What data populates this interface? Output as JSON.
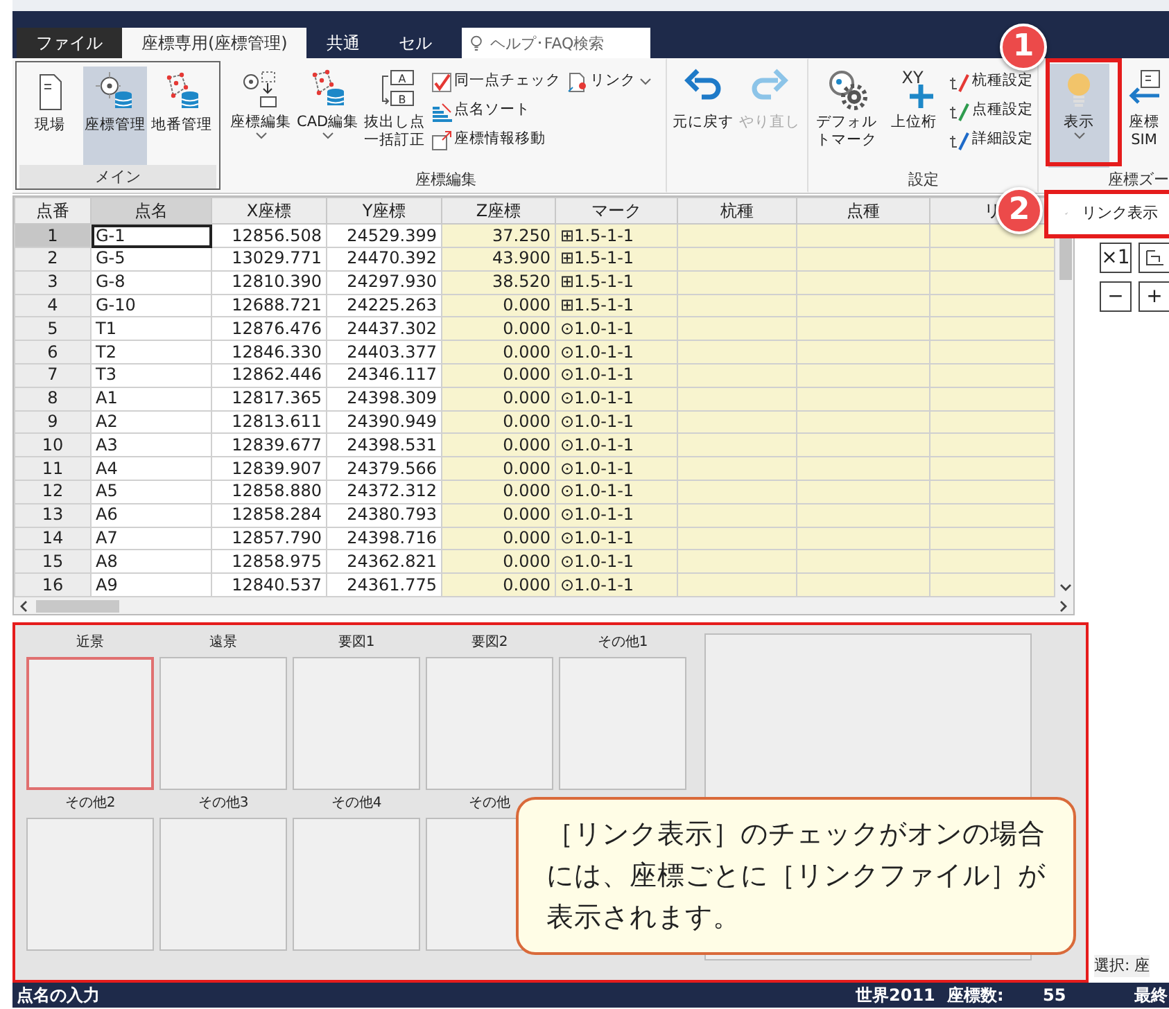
{
  "tabs": [
    {
      "label": "ファイル",
      "kind": "file",
      "selected": false
    },
    {
      "label": "座標専用(座標管理)",
      "kind": "tab",
      "selected": true
    },
    {
      "label": "共通",
      "kind": "tab",
      "selected": false
    },
    {
      "label": "セル",
      "kind": "tab",
      "selected": false
    }
  ],
  "search": {
    "placeholder": "ヘルプ･FAQ検索"
  },
  "ribbon_groups": [
    {
      "title": "メイン",
      "outlined": true,
      "items": [
        {
          "kind": "large",
          "label": "現場",
          "selected": false,
          "dropdown": false,
          "disabled": false
        },
        {
          "kind": "large",
          "label": "座標管理",
          "selected": true,
          "dropdown": false,
          "disabled": false
        },
        {
          "kind": "large",
          "label": "地番管理",
          "selected": false,
          "dropdown": false,
          "disabled": false
        }
      ]
    },
    {
      "title": "座標編集",
      "outlined": false,
      "items": [
        {
          "kind": "large",
          "label": "座標編集",
          "selected": false,
          "dropdown": true,
          "disabled": false
        },
        {
          "kind": "large",
          "label": "CAD編集",
          "selected": false,
          "dropdown": true,
          "disabled": false
        },
        {
          "kind": "large",
          "label": "抜出し点一括訂正",
          "icon_text": [
            "A",
            "B"
          ],
          "selected": false,
          "dropdown": false,
          "disabled": false
        },
        {
          "kind": "small",
          "label": "同一点チェック",
          "dropdown": false
        },
        {
          "kind": "small",
          "label": "点名ソート",
          "dropdown": false
        },
        {
          "kind": "small",
          "label": "座標情報移動",
          "dropdown": false
        },
        {
          "kind": "small",
          "label": "リンク",
          "dropdown": true
        }
      ]
    },
    {
      "outlined": false,
      "items": [
        {
          "kind": "large",
          "label": "元に戻す",
          "selected": false,
          "dropdown": false,
          "disabled": false
        },
        {
          "kind": "large",
          "label": "やり直し",
          "selected": false,
          "dropdown": false,
          "disabled": true
        }
      ]
    },
    {
      "title": "設定",
      "outlined": false,
      "items": [
        {
          "kind": "large",
          "label": "デフォルトマーク",
          "selected": false,
          "dropdown": false,
          "disabled": false
        },
        {
          "kind": "large",
          "label": "上位桁",
          "icon_text": [
            "XY"
          ],
          "selected": false,
          "dropdown": false,
          "disabled": false
        },
        {
          "kind": "small",
          "label": "杭種設定",
          "dropdown": false
        },
        {
          "kind": "small",
          "label": "点種設定",
          "dropdown": false
        },
        {
          "kind": "small",
          "label": "詳細設定",
          "dropdown": false
        }
      ]
    },
    {
      "title": "座標ズー",
      "outlined": false,
      "items": [
        {
          "kind": "large",
          "label": "表示",
          "selected": true,
          "dropdown": true,
          "disabled": false
        },
        {
          "kind": "large",
          "label": "座標\nSIM",
          "selected": false,
          "dropdown": false,
          "disabled": false
        }
      ]
    }
  ],
  "table": {
    "columns": [
      {
        "label": "点番",
        "kind": "number",
        "shaded": false,
        "selected": false
      },
      {
        "label": "点名",
        "kind": "name",
        "shaded": false,
        "selected": true
      },
      {
        "label": "X座標",
        "kind": "coord",
        "shaded": false,
        "selected": false
      },
      {
        "label": "Y座標",
        "kind": "coord",
        "shaded": false,
        "selected": false
      },
      {
        "label": "Z座標",
        "kind": "coord",
        "shaded": true,
        "selected": false
      },
      {
        "label": "マーク",
        "kind": "mark",
        "shaded": true,
        "selected": false
      },
      {
        "label": "杭種",
        "kind": "empty",
        "shaded": true,
        "selected": false
      },
      {
        "label": "点種",
        "kind": "empty",
        "shaded": true,
        "selected": false
      },
      {
        "label": "リ",
        "kind": "empty",
        "shaded": true,
        "selected": false
      }
    ],
    "rows": [
      {
        "selected": true,
        "cells": [
          "1",
          "G-1",
          "12856.508",
          "24529.399",
          "37.250",
          "⊞1.5-1-1"
        ]
      },
      {
        "selected": false,
        "cells": [
          "2",
          "G-5",
          "13029.771",
          "24470.392",
          "43.900",
          "⊞1.5-1-1"
        ]
      },
      {
        "selected": false,
        "cells": [
          "3",
          "G-8",
          "12810.390",
          "24297.930",
          "38.520",
          "⊞1.5-1-1"
        ]
      },
      {
        "selected": false,
        "cells": [
          "4",
          "G-10",
          "12688.721",
          "24225.263",
          "0.000",
          "⊞1.5-1-1"
        ]
      },
      {
        "selected": false,
        "cells": [
          "5",
          "T1",
          "12876.476",
          "24437.302",
          "0.000",
          "⊙1.0-1-1"
        ]
      },
      {
        "selected": false,
        "cells": [
          "6",
          "T2",
          "12846.330",
          "24403.377",
          "0.000",
          "⊙1.0-1-1"
        ]
      },
      {
        "selected": false,
        "cells": [
          "7",
          "T3",
          "12862.446",
          "24346.117",
          "0.000",
          "⊙1.0-1-1"
        ]
      },
      {
        "selected": false,
        "cells": [
          "8",
          "A1",
          "12817.365",
          "24398.309",
          "0.000",
          "⊙1.0-1-1"
        ]
      },
      {
        "selected": false,
        "cells": [
          "9",
          "A2",
          "12813.611",
          "24390.949",
          "0.000",
          "⊙1.0-1-1"
        ]
      },
      {
        "selected": false,
        "cells": [
          "10",
          "A3",
          "12839.677",
          "24398.531",
          "0.000",
          "⊙1.0-1-1"
        ]
      },
      {
        "selected": false,
        "cells": [
          "11",
          "A4",
          "12839.907",
          "24379.566",
          "0.000",
          "⊙1.0-1-1"
        ]
      },
      {
        "selected": false,
        "cells": [
          "12",
          "A5",
          "12858.880",
          "24372.312",
          "0.000",
          "⊙1.0-1-1"
        ]
      },
      {
        "selected": false,
        "cells": [
          "13",
          "A6",
          "12858.284",
          "24380.793",
          "0.000",
          "⊙1.0-1-1"
        ]
      },
      {
        "selected": false,
        "cells": [
          "14",
          "A7",
          "12857.790",
          "24398.716",
          "0.000",
          "⊙1.0-1-1"
        ]
      },
      {
        "selected": false,
        "cells": [
          "15",
          "A8",
          "12858.975",
          "24362.821",
          "0.000",
          "⊙1.0-1-1"
        ]
      },
      {
        "selected": false,
        "cells": [
          "16",
          "A9",
          "12840.537",
          "24361.775",
          "0.000",
          "⊙1.0-1-1"
        ]
      }
    ]
  },
  "display_menu": {
    "items": [
      {
        "label": "リンク表示",
        "checked": true
      }
    ]
  },
  "zoom_buttons": [
    {
      "kind": "text",
      "label": "×1"
    },
    {
      "kind": "fit"
    },
    {
      "kind": "text",
      "label": "−"
    },
    {
      "kind": "text",
      "label": "+"
    }
  ],
  "link_panel": {
    "thumbnails": [
      {
        "label": "近景",
        "selected": true
      },
      {
        "label": "遠景",
        "selected": false
      },
      {
        "label": "要図1",
        "selected": false
      },
      {
        "label": "要図2",
        "selected": false
      },
      {
        "label": "その他1",
        "selected": false
      },
      {
        "label": "その他2",
        "selected": false
      },
      {
        "label": "その他3",
        "selected": false
      },
      {
        "label": "その他4",
        "selected": false
      },
      {
        "label": "その他",
        "selected": false
      }
    ]
  },
  "selection_label": "選択: 座",
  "callouts": [
    {
      "number": "1"
    },
    {
      "number": "2"
    }
  ],
  "note": "［リンク表示］のチェックがオンの場合には、座標ごとに［リンクファイル］が表示されます。",
  "status_bar": {
    "left": "点名の入力",
    "items": [
      "世界2011",
      "座標数:",
      "55",
      "最終"
    ]
  }
}
